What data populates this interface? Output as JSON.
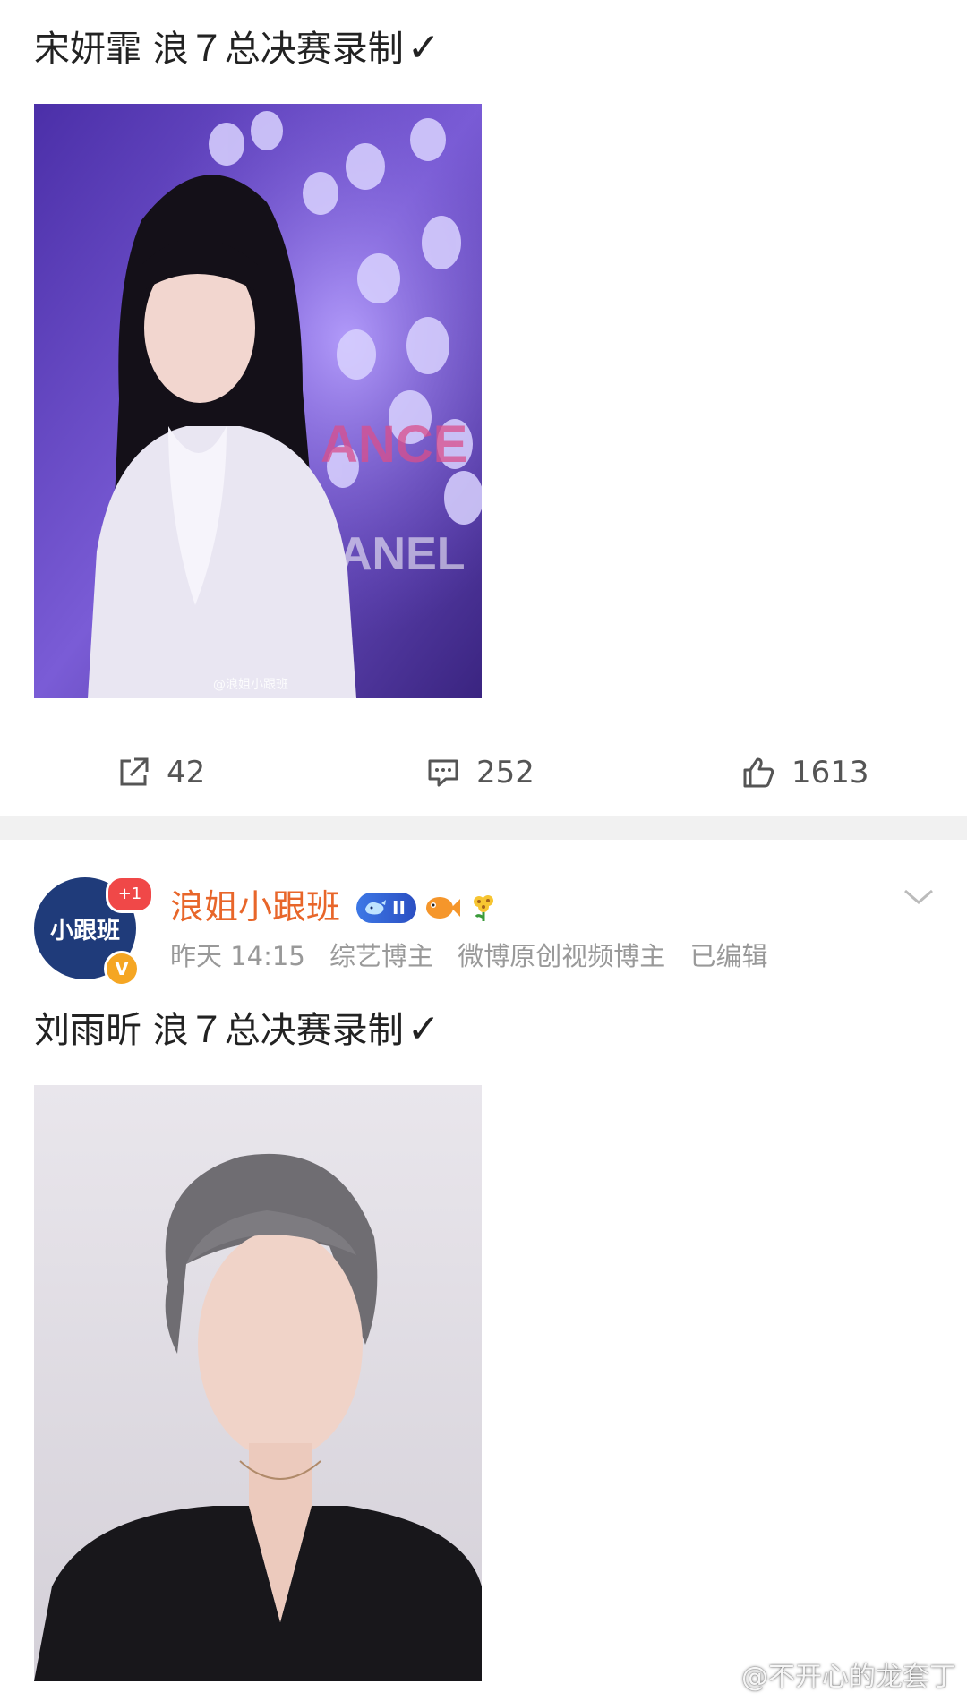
{
  "post1": {
    "text": "宋妍霏  浪７总决赛录制",
    "check": "✓",
    "photo_watermark": "@浪姐小跟班",
    "actions": {
      "repost_count": "42",
      "comment_count": "252",
      "like_count": "1613"
    }
  },
  "post2": {
    "author": {
      "avatar_text": "小跟班",
      "notification_badge": "+1",
      "verified_badge": "V",
      "name": "浪姐小跟班",
      "level_badge": "II"
    },
    "meta": {
      "time": "昨天 14:15",
      "tag1": "综艺博主",
      "tag2": "微博原创视频博主",
      "edited": "已编辑"
    },
    "text": "刘雨昕  浪７总决赛录制",
    "check": "✓"
  },
  "watermark": "@不开心的龙套丁",
  "colors": {
    "accent_orange": "#e8662a",
    "meta_gray": "#999999",
    "verified_gold": "#f5a623",
    "notify_red": "#f04848",
    "avatar_navy": "#1f3b7a",
    "photo1_purple": "#7a5cd6"
  }
}
